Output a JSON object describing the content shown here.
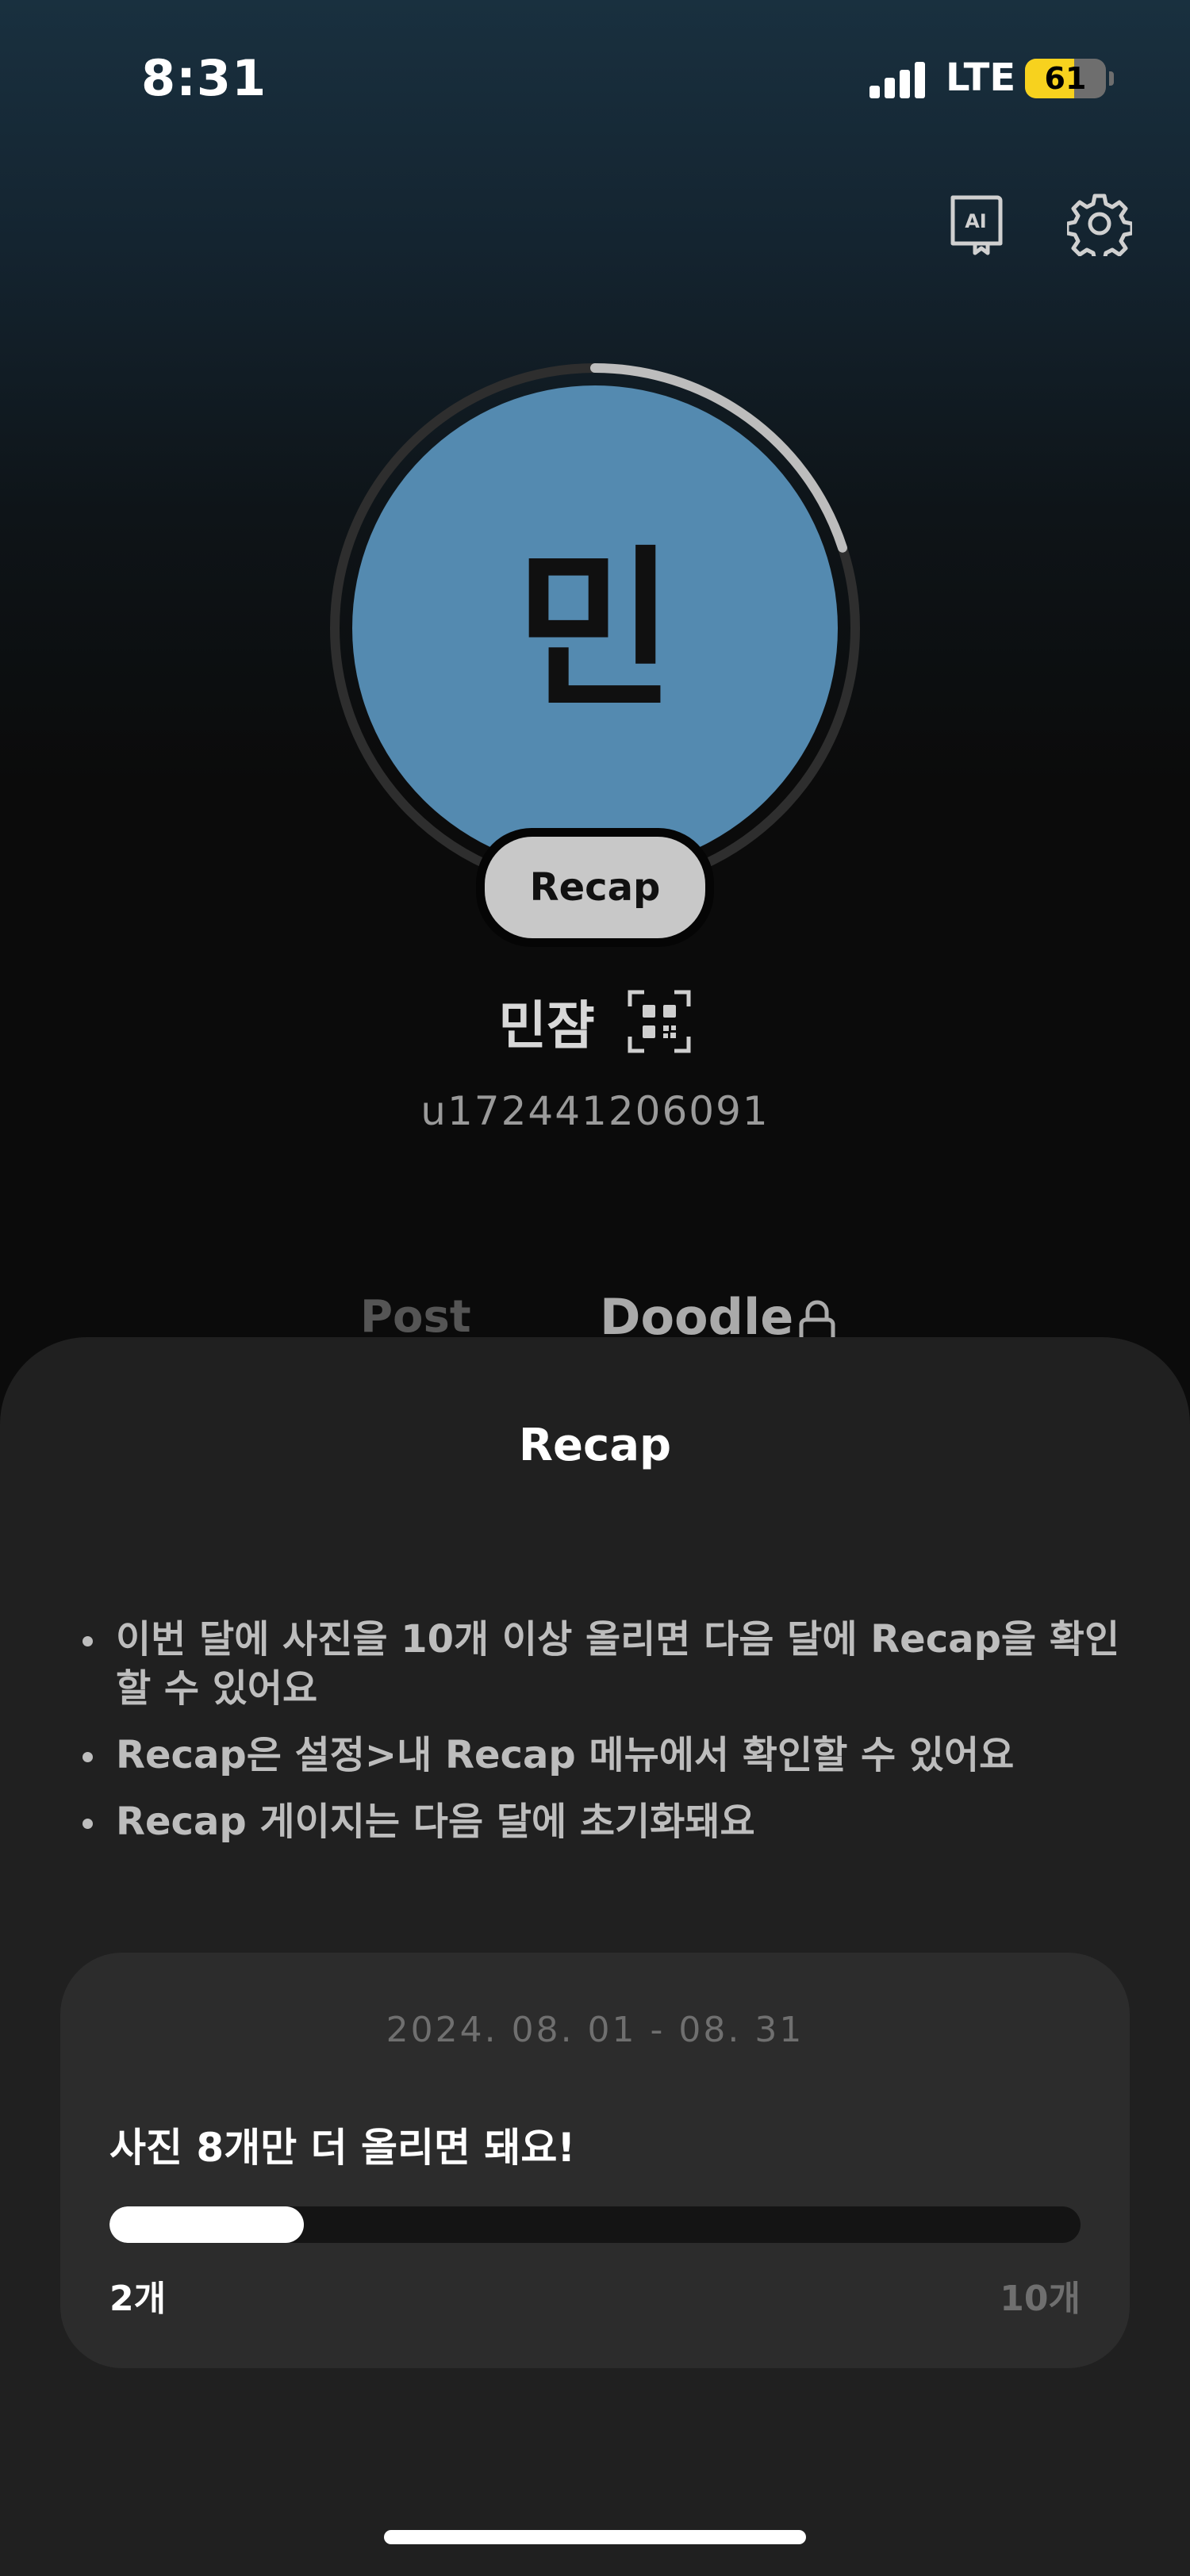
{
  "status_bar": {
    "time": "8:31",
    "network": "LTE",
    "battery": "61",
    "battery_level": 0.61
  },
  "header": {
    "icons": [
      "ai-guide-icon",
      "gear-icon"
    ]
  },
  "profile": {
    "initial": "민",
    "recap_label": "Recap",
    "recap_progress": 0.2,
    "name": "민쟘",
    "user_id": "u172441206091",
    "accent": "#548ab0"
  },
  "tabs": [
    {
      "label": "Post"
    },
    {
      "label": "Doodle"
    }
  ],
  "sheet": {
    "title": "Recap",
    "bullets": [
      "이번 달에 사진을 10개 이상 올리면 다음 달에 Recap을 확인할 수 있어요",
      "Recap은 설정>내 Recap 메뉴에서 확인할 수 있어요",
      "Recap 게이지는 다음 달에 초기화돼요"
    ],
    "card": {
      "date_range": "2024. 08. 01 - 08. 31",
      "message": "사진 8개만 더 올리면 돼요!",
      "progress": 0.2,
      "min_label": "2개",
      "max_label": "10개"
    }
  }
}
